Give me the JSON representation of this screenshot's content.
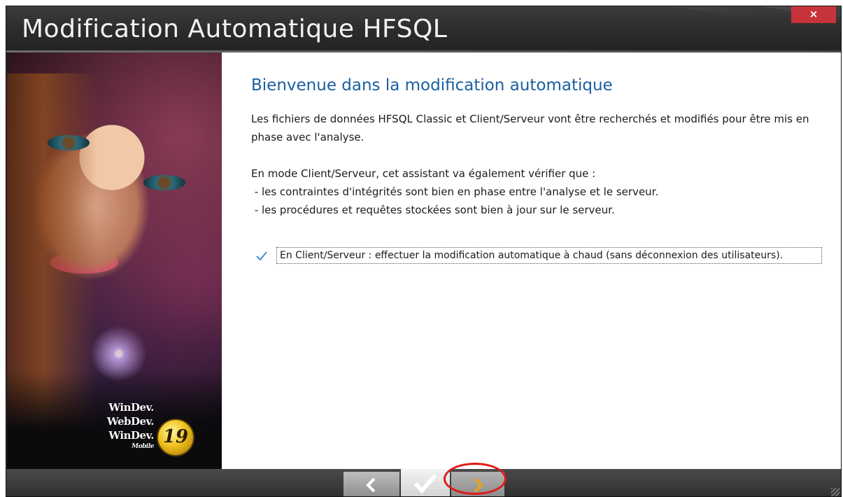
{
  "window": {
    "title": "Modification Automatique HFSQL",
    "close_label": "×"
  },
  "branding": {
    "logos": [
      "WinDev.",
      "WebDev.",
      "WinDev."
    ],
    "logo_sub": "Mobile",
    "version": "19"
  },
  "content": {
    "heading": "Bienvenue dans la modification automatique",
    "paragraph1": "Les fichiers de données HFSQL Classic et Client/Serveur vont être recherchés et modifiés pour être mis en phase avec l'analyse.",
    "paragraph2_lines": [
      "En mode Client/Serveur, cet assistant va également vérifier que :",
      " - les contraintes d'intégrités sont bien en phase entre l'analyse et le serveur.",
      " - les procédures et requêtes stockées sont bien à jour sur le serveur."
    ],
    "option": {
      "checked": true,
      "label": "En Client/Serveur : effectuer la modification automatique à chaud (sans déconnexion des utilisateurs)."
    }
  },
  "navigation": {
    "buttons": [
      {
        "name": "previous",
        "icon": "chevron-left-icon"
      },
      {
        "name": "finish",
        "icon": "checkmark-icon"
      },
      {
        "name": "next",
        "icon": "chevron-right-icon"
      }
    ]
  },
  "colors": {
    "heading": "#1a5fa0",
    "close_button": "#c7333b",
    "next_arrow": "#e6a31a",
    "highlight_ring": "#e01919",
    "checkbox_check": "#3a8fd6"
  }
}
